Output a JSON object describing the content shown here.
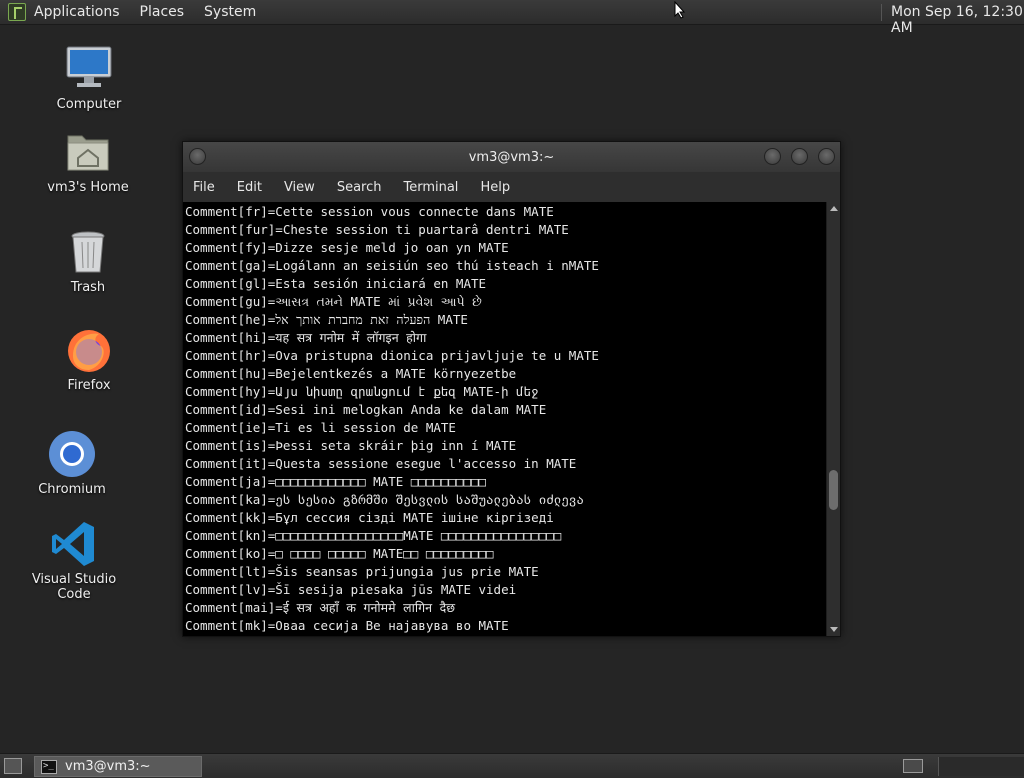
{
  "top_panel": {
    "menus": [
      "Applications",
      "Places",
      "System"
    ],
    "clock": "Mon Sep 16, 12:30 AM"
  },
  "desktop_icons": [
    {
      "label": "Computer",
      "icon": "computer-icon"
    },
    {
      "label": "vm3's Home",
      "icon": "home-folder-icon"
    },
    {
      "label": "Trash",
      "icon": "trash-icon"
    },
    {
      "label": "Firefox",
      "icon": "firefox-icon"
    },
    {
      "label": "Chromium",
      "icon": "chromium-icon"
    },
    {
      "label": "Visual Studio Code",
      "icon": "vscode-icon"
    }
  ],
  "terminal": {
    "title": "vm3@vm3:~",
    "menu": [
      "File",
      "Edit",
      "View",
      "Search",
      "Terminal",
      "Help"
    ],
    "lines": [
      "Comment[fr]=Cette session vous connecte dans MATE",
      "Comment[fur]=Cheste session ti puartarâ dentri MATE",
      "Comment[fy]=Dizze sesje meld jo oan yn MATE",
      "Comment[ga]=Logálann an seisiún seo thú isteach i nMATE",
      "Comment[gl]=Esta sesión iniciará en MATE",
      "Comment[gu]=આસત્ર તમને MATE માં પ્રવેશ આપે છે",
      "Comment[he]=הפעלה זאת מחברת אותך אל MATE",
      "Comment[hi]=यह सत्र गनोम में लॉगइन होगा",
      "Comment[hr]=Ova pristupna dionica prijavljuje te u MATE",
      "Comment[hu]=Bejelentkezés a MATE környezetbe",
      "Comment[hy]=Այս նիստը զրանցում է քեզ MATE-ի մեջ",
      "Comment[id]=Sesi ini melogkan Anda ke dalam MATE",
      "Comment[ie]=Ti es li session de MATE",
      "Comment[is]=Þessi seta skráir þig inn í MATE",
      "Comment[it]=Questa sessione esegue l'accesso in MATE",
      "Comment[ja]=□□□□□□□□□□□□ MATE □□□□□□□□□□",
      "Comment[ka]=ეს სესია გზრმში შესვლის საშუალებას იძლევა",
      "Comment[kk]=Бұл сессия сізді MATE ішіне кіргізеді",
      "Comment[kn]=□□□□□□□□□□□□□□□□□MATE □□□□□□□□□□□□□□□□",
      "Comment[ko]=□ □□□□ □□□□□ MATE□□ □□□□□□□□□",
      "Comment[lt]=Šis seansas prijungia jus prie MATE",
      "Comment[lv]=Šī sesija piesaka jūs MATE videi",
      "Comment[mai]=ई सत्र अहाँ क गनोममे लागिन दैछ",
      "Comment[mk]=Оваа сесија Ве најавува во MATE"
    ]
  },
  "bottom_panel": {
    "task_label": "vm3@vm3:~"
  }
}
